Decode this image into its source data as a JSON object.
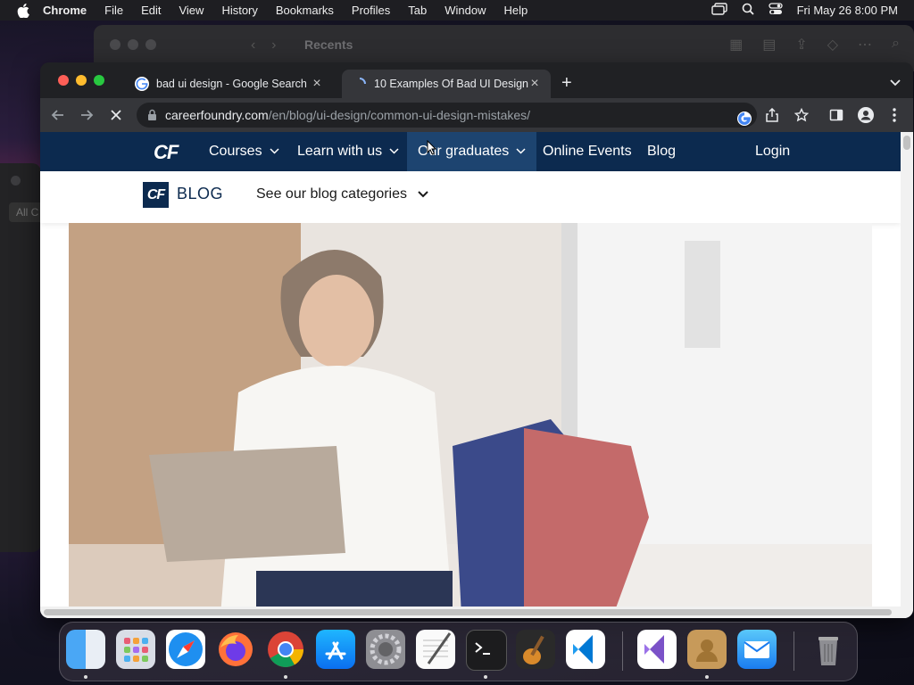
{
  "menubar": {
    "app": "Chrome",
    "items": [
      "File",
      "Edit",
      "View",
      "History",
      "Bookmarks",
      "Profiles",
      "Tab",
      "Window",
      "Help"
    ],
    "clock": "Fri May 26  8:00 PM"
  },
  "finder": {
    "title": "Recents"
  },
  "sidewin": {
    "label": "All C"
  },
  "chrome": {
    "tabs": [
      {
        "title": "bad ui design - Google Search",
        "active": false
      },
      {
        "title": "10 Examples Of Bad UI Design",
        "active": true
      }
    ],
    "url_host": "careerfoundry.com",
    "url_path": "/en/blog/ui-design/common-ui-design-mistakes/"
  },
  "site": {
    "logo": "CF",
    "nav": [
      {
        "label": "Courses",
        "has_dropdown": true
      },
      {
        "label": "Learn with us",
        "has_dropdown": true
      },
      {
        "label": "Our graduates",
        "has_dropdown": true
      },
      {
        "label": "Online Events",
        "has_dropdown": false
      },
      {
        "label": "Blog",
        "has_dropdown": false
      }
    ],
    "login": "Login",
    "blog_badge": "CF",
    "blog_word": "BLOG",
    "categories": "See our blog categories"
  },
  "colors": {
    "site_nav_bg": "#0c2a4f",
    "chrome_dark": "#202124",
    "chrome_toolbar": "#35363a"
  },
  "dock_icons": [
    "finder-icon",
    "launchpad-icon",
    "safari-icon",
    "firefox-icon",
    "chrome-icon",
    "app-store-icon",
    "system-preferences-icon",
    "textedit-icon",
    "terminal-icon",
    "garageband-icon",
    "vscode-icon",
    "visual-studio-icon",
    "contacts-icon",
    "mail-icon",
    "trash-icon"
  ]
}
